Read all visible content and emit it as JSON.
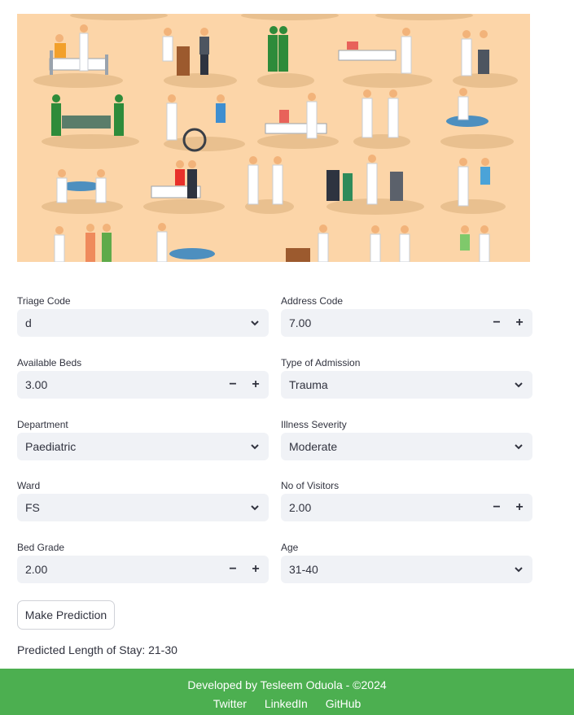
{
  "hero_image": {
    "alt": "hospital illustration",
    "background": "#fcd5a8"
  },
  "form": {
    "triage_code": {
      "label": "Triage Code",
      "value": "d"
    },
    "address_code": {
      "label": "Address Code",
      "value": "7.00"
    },
    "available_beds": {
      "label": "Available Beds",
      "value": "3.00"
    },
    "type_of_admission": {
      "label": "Type of Admission",
      "value": "Trauma"
    },
    "department": {
      "label": "Department",
      "value": "Paediatric"
    },
    "illness_severity": {
      "label": "Illness Severity",
      "value": "Moderate"
    },
    "ward": {
      "label": "Ward",
      "value": "FS"
    },
    "no_of_visitors": {
      "label": "No of Visitors",
      "value": "2.00"
    },
    "bed_grade": {
      "label": "Bed Grade",
      "value": "2.00"
    },
    "age": {
      "label": "Age",
      "value": "31-40"
    }
  },
  "stepper": {
    "minus": "−",
    "plus": "+"
  },
  "predict_button": {
    "label": "Make Prediction"
  },
  "result": {
    "text": "Predicted Length of Stay: 21-30"
  },
  "footer": {
    "credit": "Developed by Tesleem Oduola - ©2024",
    "links": [
      "Twitter",
      "LinkedIn",
      "GitHub"
    ],
    "color": "#4caf50"
  },
  "icons": {
    "select": "chevron-down-icon"
  }
}
